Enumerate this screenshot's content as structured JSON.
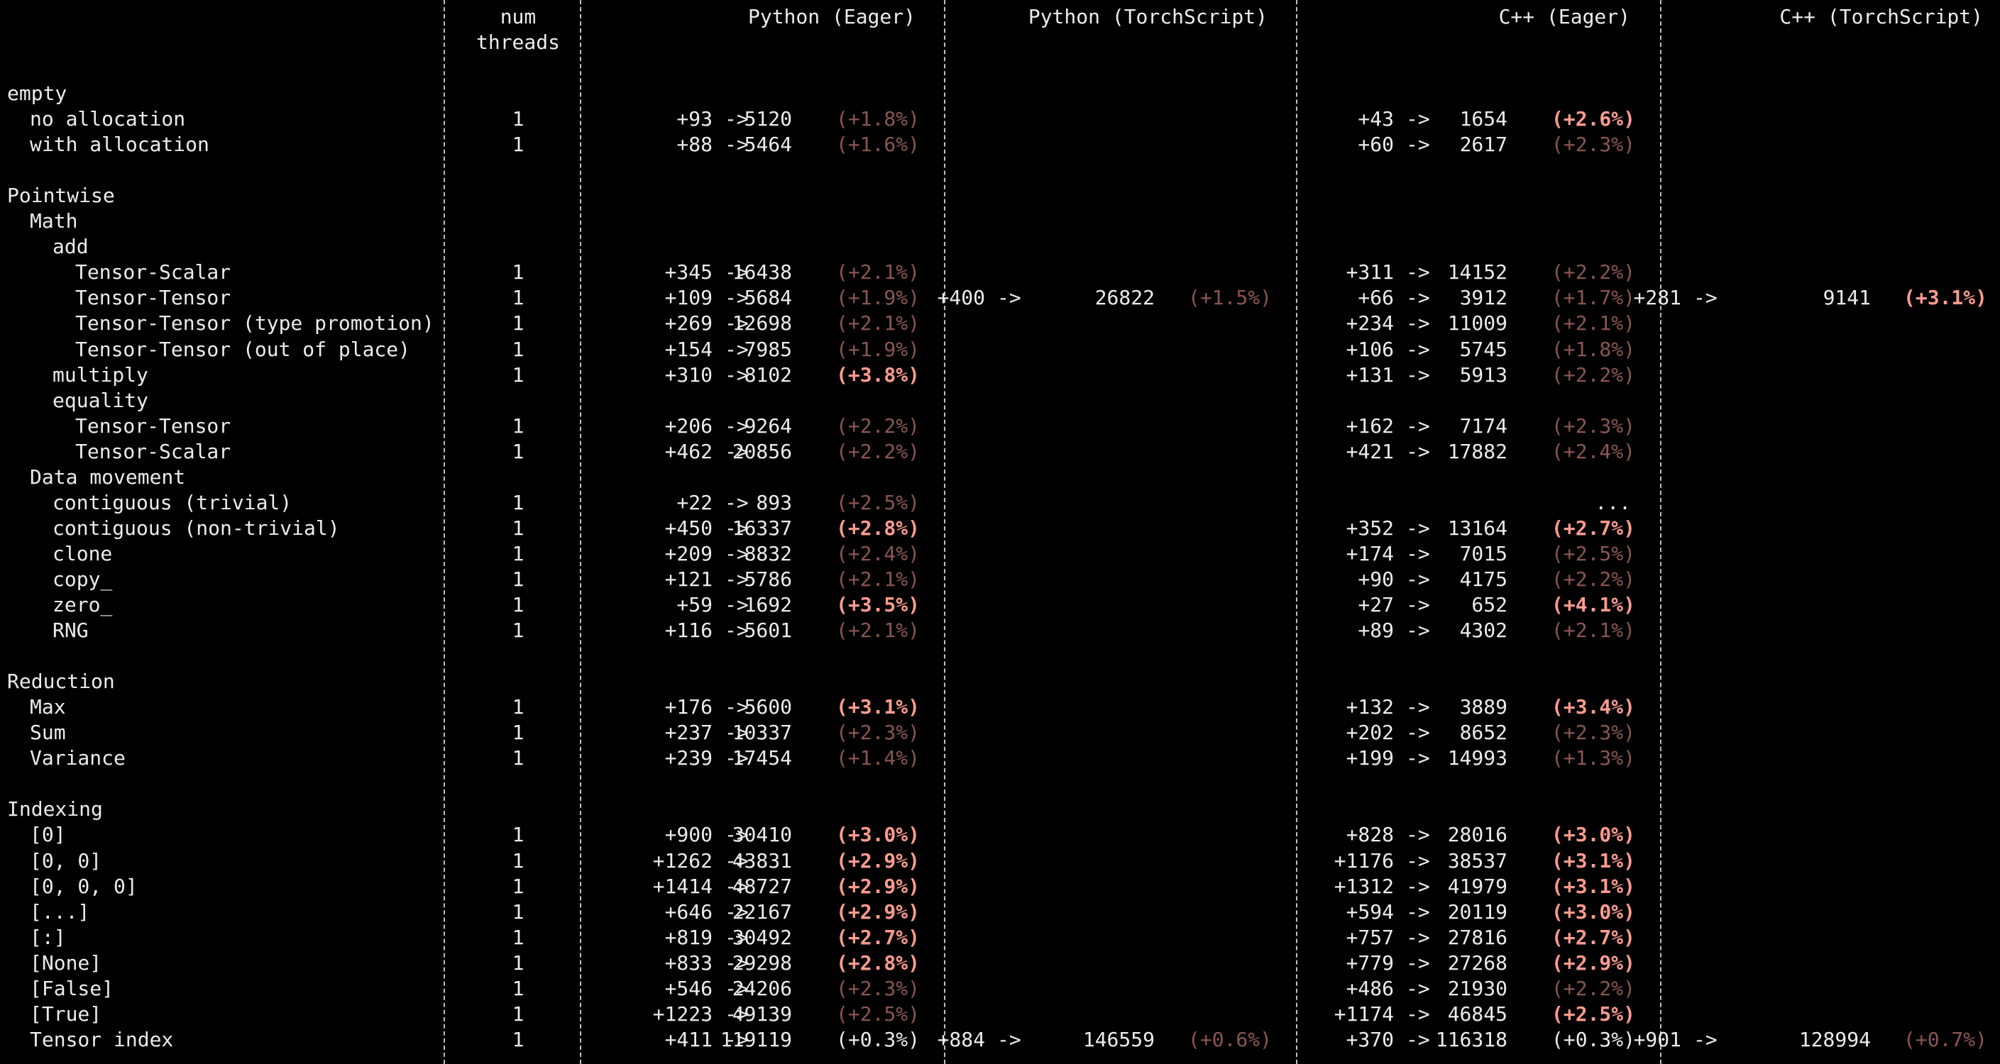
{
  "colors": {
    "background": "#000000",
    "text": "#ececec",
    "pct_low": "#8a5651",
    "pct_high": "#ff9b8f",
    "separator": "#bfbfbf"
  },
  "header": {
    "threads_top": "num",
    "threads_bottom": "threads",
    "groups": [
      "Python (Eager)",
      "Python (TorchScript)",
      "C++ (Eager)",
      "C++ (TorchScript)"
    ]
  },
  "rows": [
    {
      "label": "empty",
      "indent": 0
    },
    {
      "label": "no allocation",
      "indent": 1,
      "threads": "1",
      "cells": [
        {
          "delta": "+93",
          "value": "5120",
          "pct": "(+1.8%)",
          "level": "lo"
        },
        null,
        {
          "delta": "+43",
          "value": "1654",
          "pct": "(+2.6%)",
          "level": "hi"
        },
        null
      ]
    },
    {
      "label": "with allocation",
      "indent": 1,
      "threads": "1",
      "cells": [
        {
          "delta": "+88",
          "value": "5464",
          "pct": "(+1.6%)",
          "level": "lo"
        },
        null,
        {
          "delta": "+60",
          "value": "2617",
          "pct": "(+2.3%)",
          "level": "lo"
        },
        null
      ]
    },
    {
      "label": "",
      "indent": 0
    },
    {
      "label": "Pointwise",
      "indent": 0
    },
    {
      "label": "Math",
      "indent": 1
    },
    {
      "label": "add",
      "indent": 2
    },
    {
      "label": "Tensor-Scalar",
      "indent": 3,
      "threads": "1",
      "cells": [
        {
          "delta": "+345",
          "value": "16438",
          "pct": "(+2.1%)",
          "level": "lo"
        },
        null,
        {
          "delta": "+311",
          "value": "14152",
          "pct": "(+2.2%)",
          "level": "lo"
        },
        null
      ]
    },
    {
      "label": "Tensor-Tensor",
      "indent": 3,
      "threads": "1",
      "cells": [
        {
          "delta": "+109",
          "value": "5684",
          "pct": "(+1.9%)",
          "level": "lo"
        },
        {
          "delta": "+400",
          "value": "26822",
          "pct": "(+1.5%)",
          "level": "lo"
        },
        {
          "delta": "+66",
          "value": "3912",
          "pct": "(+1.7%)",
          "level": "lo"
        },
        {
          "delta": "+281",
          "value": "9141",
          "pct": "(+3.1%)",
          "level": "hi"
        }
      ]
    },
    {
      "label": "Tensor-Tensor (type promotion)",
      "indent": 3,
      "threads": "1",
      "cells": [
        {
          "delta": "+269",
          "value": "12698",
          "pct": "(+2.1%)",
          "level": "lo"
        },
        null,
        {
          "delta": "+234",
          "value": "11009",
          "pct": "(+2.1%)",
          "level": "lo"
        },
        null
      ]
    },
    {
      "label": "Tensor-Tensor (out of place)",
      "indent": 3,
      "threads": "1",
      "cells": [
        {
          "delta": "+154",
          "value": "7985",
          "pct": "(+1.9%)",
          "level": "lo"
        },
        null,
        {
          "delta": "+106",
          "value": "5745",
          "pct": "(+1.8%)",
          "level": "lo"
        },
        null
      ]
    },
    {
      "label": "multiply",
      "indent": 2,
      "threads": "1",
      "cells": [
        {
          "delta": "+310",
          "value": "8102",
          "pct": "(+3.8%)",
          "level": "hi"
        },
        null,
        {
          "delta": "+131",
          "value": "5913",
          "pct": "(+2.2%)",
          "level": "lo"
        },
        null
      ]
    },
    {
      "label": "equality",
      "indent": 2
    },
    {
      "label": "Tensor-Tensor",
      "indent": 3,
      "threads": "1",
      "cells": [
        {
          "delta": "+206",
          "value": "9264",
          "pct": "(+2.2%)",
          "level": "lo"
        },
        null,
        {
          "delta": "+162",
          "value": "7174",
          "pct": "(+2.3%)",
          "level": "lo"
        },
        null
      ]
    },
    {
      "label": "Tensor-Scalar",
      "indent": 3,
      "threads": "1",
      "cells": [
        {
          "delta": "+462",
          "value": "20856",
          "pct": "(+2.2%)",
          "level": "lo"
        },
        null,
        {
          "delta": "+421",
          "value": "17882",
          "pct": "(+2.4%)",
          "level": "lo"
        },
        null
      ]
    },
    {
      "label": "Data movement",
      "indent": 1
    },
    {
      "label": "contiguous (trivial)",
      "indent": 2,
      "threads": "1",
      "cells": [
        {
          "delta": "+22",
          "value": "893",
          "pct": "(+2.5%)",
          "level": "lo"
        },
        null,
        {
          "ellipsis": "..."
        },
        null
      ]
    },
    {
      "label": "contiguous (non-trivial)",
      "indent": 2,
      "threads": "1",
      "cells": [
        {
          "delta": "+450",
          "value": "16337",
          "pct": "(+2.8%)",
          "level": "hi"
        },
        null,
        {
          "delta": "+352",
          "value": "13164",
          "pct": "(+2.7%)",
          "level": "hi"
        },
        null
      ]
    },
    {
      "label": "clone",
      "indent": 2,
      "threads": "1",
      "cells": [
        {
          "delta": "+209",
          "value": "8832",
          "pct": "(+2.4%)",
          "level": "lo"
        },
        null,
        {
          "delta": "+174",
          "value": "7015",
          "pct": "(+2.5%)",
          "level": "lo"
        },
        null
      ]
    },
    {
      "label": "copy_",
      "indent": 2,
      "threads": "1",
      "cells": [
        {
          "delta": "+121",
          "value": "5786",
          "pct": "(+2.1%)",
          "level": "lo"
        },
        null,
        {
          "delta": "+90",
          "value": "4175",
          "pct": "(+2.2%)",
          "level": "lo"
        },
        null
      ]
    },
    {
      "label": "zero_",
      "indent": 2,
      "threads": "1",
      "cells": [
        {
          "delta": "+59",
          "value": "1692",
          "pct": "(+3.5%)",
          "level": "hi"
        },
        null,
        {
          "delta": "+27",
          "value": "652",
          "pct": "(+4.1%)",
          "level": "hi"
        },
        null
      ]
    },
    {
      "label": "RNG",
      "indent": 2,
      "threads": "1",
      "cells": [
        {
          "delta": "+116",
          "value": "5601",
          "pct": "(+2.1%)",
          "level": "lo"
        },
        null,
        {
          "delta": "+89",
          "value": "4302",
          "pct": "(+2.1%)",
          "level": "lo"
        },
        null
      ]
    },
    {
      "label": "",
      "indent": 0
    },
    {
      "label": "Reduction",
      "indent": 0
    },
    {
      "label": "Max",
      "indent": 1,
      "threads": "1",
      "cells": [
        {
          "delta": "+176",
          "value": "5600",
          "pct": "(+3.1%)",
          "level": "hi"
        },
        null,
        {
          "delta": "+132",
          "value": "3889",
          "pct": "(+3.4%)",
          "level": "hi"
        },
        null
      ]
    },
    {
      "label": "Sum",
      "indent": 1,
      "threads": "1",
      "cells": [
        {
          "delta": "+237",
          "value": "10337",
          "pct": "(+2.3%)",
          "level": "lo"
        },
        null,
        {
          "delta": "+202",
          "value": "8652",
          "pct": "(+2.3%)",
          "level": "lo"
        },
        null
      ]
    },
    {
      "label": "Variance",
      "indent": 1,
      "threads": "1",
      "cells": [
        {
          "delta": "+239",
          "value": "17454",
          "pct": "(+1.4%)",
          "level": "lo"
        },
        null,
        {
          "delta": "+199",
          "value": "14993",
          "pct": "(+1.3%)",
          "level": "lo"
        },
        null
      ]
    },
    {
      "label": "",
      "indent": 0
    },
    {
      "label": "Indexing",
      "indent": 0
    },
    {
      "label": "[0]",
      "indent": 1,
      "threads": "1",
      "cells": [
        {
          "delta": "+900",
          "value": "30410",
          "pct": "(+3.0%)",
          "level": "hi"
        },
        null,
        {
          "delta": "+828",
          "value": "28016",
          "pct": "(+3.0%)",
          "level": "hi"
        },
        null
      ]
    },
    {
      "label": "[0, 0]",
      "indent": 1,
      "threads": "1",
      "cells": [
        {
          "delta": "+1262",
          "value": "43831",
          "pct": "(+2.9%)",
          "level": "hi"
        },
        null,
        {
          "delta": "+1176",
          "value": "38537",
          "pct": "(+3.1%)",
          "level": "hi"
        },
        null
      ]
    },
    {
      "label": "[0, 0, 0]",
      "indent": 1,
      "threads": "1",
      "cells": [
        {
          "delta": "+1414",
          "value": "48727",
          "pct": "(+2.9%)",
          "level": "hi"
        },
        null,
        {
          "delta": "+1312",
          "value": "41979",
          "pct": "(+3.1%)",
          "level": "hi"
        },
        null
      ]
    },
    {
      "label": "[...]",
      "indent": 1,
      "threads": "1",
      "cells": [
        {
          "delta": "+646",
          "value": "22167",
          "pct": "(+2.9%)",
          "level": "hi"
        },
        null,
        {
          "delta": "+594",
          "value": "20119",
          "pct": "(+3.0%)",
          "level": "hi"
        },
        null
      ]
    },
    {
      "label": "[:]",
      "indent": 1,
      "threads": "1",
      "cells": [
        {
          "delta": "+819",
          "value": "30492",
          "pct": "(+2.7%)",
          "level": "hi"
        },
        null,
        {
          "delta": "+757",
          "value": "27816",
          "pct": "(+2.7%)",
          "level": "hi"
        },
        null
      ]
    },
    {
      "label": "[None]",
      "indent": 1,
      "threads": "1",
      "cells": [
        {
          "delta": "+833",
          "value": "29298",
          "pct": "(+2.8%)",
          "level": "hi"
        },
        null,
        {
          "delta": "+779",
          "value": "27268",
          "pct": "(+2.9%)",
          "level": "hi"
        },
        null
      ]
    },
    {
      "label": "[False]",
      "indent": 1,
      "threads": "1",
      "cells": [
        {
          "delta": "+546",
          "value": "24206",
          "pct": "(+2.3%)",
          "level": "lo"
        },
        null,
        {
          "delta": "+486",
          "value": "21930",
          "pct": "(+2.2%)",
          "level": "lo"
        },
        null
      ]
    },
    {
      "label": "[True]",
      "indent": 1,
      "threads": "1",
      "cells": [
        {
          "delta": "+1223",
          "value": "49139",
          "pct": "(+2.5%)",
          "level": "lo"
        },
        null,
        {
          "delta": "+1174",
          "value": "46845",
          "pct": "(+2.5%)",
          "level": "hi"
        },
        null
      ]
    },
    {
      "label": "Tensor index",
      "indent": 1,
      "threads": "1",
      "cells": [
        {
          "delta": "+411",
          "value": "119119",
          "pct": "(+0.3%)",
          "level": "wh"
        },
        {
          "delta": "+884",
          "value": "146559",
          "pct": "(+0.6%)",
          "level": "lo"
        },
        {
          "delta": "+370",
          "value": "116318",
          "pct": "(+0.3%)",
          "level": "wh"
        },
        {
          "delta": "+901",
          "value": "128994",
          "pct": "(+0.7%)",
          "level": "lo"
        }
      ]
    }
  ]
}
